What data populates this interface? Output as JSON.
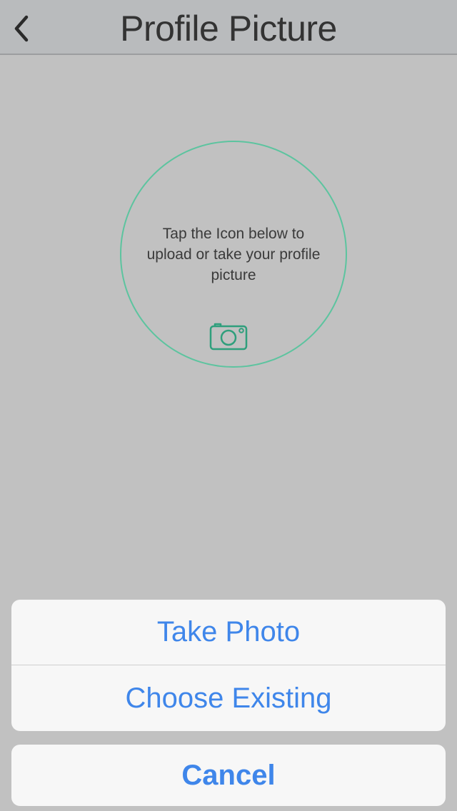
{
  "nav": {
    "title": "Profile Picture",
    "back_icon": "chevron-left-icon"
  },
  "avatar": {
    "hint_lines": [
      "Tap the Icon below to",
      "upload or take your profile",
      "picture"
    ],
    "camera_icon": "camera-icon"
  },
  "action_sheet": {
    "take_photo": "Take Photo",
    "choose_existing": "Choose Existing",
    "cancel": "Cancel"
  },
  "colors": {
    "background": "#c1c1c1",
    "navbar": "#b9bbbd",
    "accent_green": "#5cc49f",
    "icon_green": "#2f9f7c",
    "action_blue": "#3f86ea",
    "sheet_bg": "#f7f7f7"
  }
}
